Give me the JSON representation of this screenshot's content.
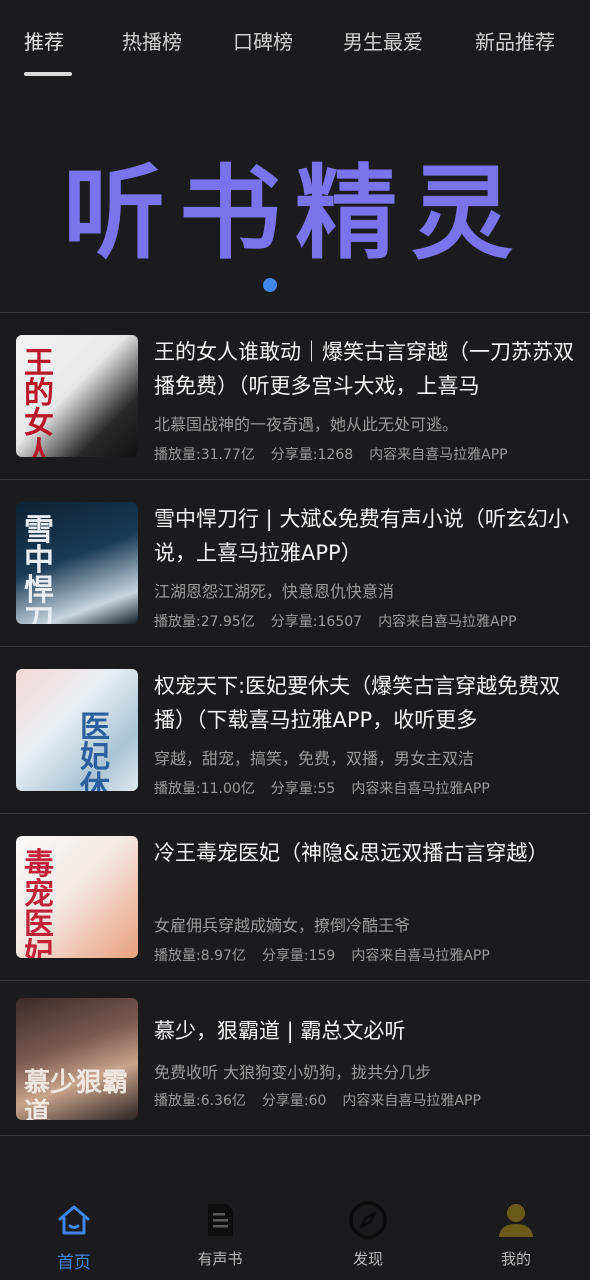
{
  "tabs": [
    {
      "label": "推荐",
      "active": true
    },
    {
      "label": "热播榜"
    },
    {
      "label": "口碑榜"
    },
    {
      "label": "男生最爱"
    },
    {
      "label": "新品推荐"
    }
  ],
  "banner": {
    "title": "听书精灵",
    "title_color": "#7a73ec",
    "dot_color": "#3f86e8"
  },
  "books": [
    {
      "title": "王的女人谁敢动｜爆笑古言穿越（一刀苏苏双播免费）（听更多宫斗大戏，上喜马",
      "desc": "北慕国战神的一夜奇遇，她从此无处可逃。",
      "plays": "播放量:31.77亿",
      "shares": "分享量:1268",
      "source": "内容来自喜马拉雅APP",
      "cover_text": "王的女人"
    },
    {
      "title": "雪中悍刀行 | 大斌&免费有声小说（听玄幻小说，上喜马拉雅APP）",
      "desc": "江湖恩怨江湖死，快意恩仇快意消",
      "plays": "播放量:27.95亿",
      "shares": "分享量:16507",
      "source": "内容来自喜马拉雅APP",
      "cover_text": "雪中悍刀行"
    },
    {
      "title": "权宠天下:医妃要休夫（爆笑古言穿越免费双播）（下载喜马拉雅APP，收听更多",
      "desc": "穿越，甜宠，搞笑，免费，双播，男女主双洁",
      "plays": "播放量:11.00亿",
      "shares": "分享量:55",
      "source": "内容来自喜马拉雅APP",
      "cover_text": "医妃休"
    },
    {
      "title": "冷王毒宠医妃（神隐&思远双播古言穿越）",
      "desc": "女雇佣兵穿越成嫡女，撩倒冷酷王爷",
      "plays": "播放量:8.97亿",
      "shares": "分享量:159",
      "source": "内容来自喜马拉雅APP",
      "cover_text": "毒宠医妃"
    },
    {
      "title": "慕少，狠霸道 | 霸总文必听",
      "desc": "免费收听 大狼狗变小奶狗，拢共分几步",
      "plays": "播放量:6.36亿",
      "shares": "分享量:60",
      "source": "内容来自喜马拉雅APP",
      "cover_text": "慕少狠霸道"
    }
  ],
  "bottom_nav": [
    {
      "label": "首页",
      "icon": "home-icon",
      "active": true
    },
    {
      "label": "有声书",
      "icon": "book-icon"
    },
    {
      "label": "发现",
      "icon": "compass-icon"
    },
    {
      "label": "我的",
      "icon": "user-icon"
    }
  ],
  "colors": {
    "background": "#1b1b1d",
    "accent": "#3f86e8",
    "user_icon": "#6b5a1a"
  }
}
